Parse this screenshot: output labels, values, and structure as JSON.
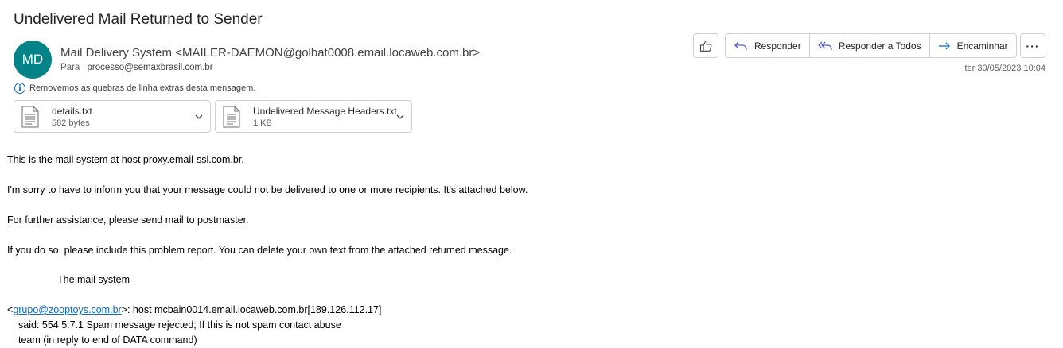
{
  "email": {
    "subject": "Undelivered Mail Returned to Sender",
    "avatar_initials": "MD",
    "avatar_color": "#038387",
    "sender": "Mail Delivery System <MAILER-DAEMON@golbat0008.email.locaweb.com.br>",
    "to_label": "Para",
    "to_address": "processo@semaxbrasil.com.br",
    "info_notice": "Removemos as quebras de linha extras desta mensagem.",
    "date": "ter 30/05/2023 10:04"
  },
  "actions": {
    "like_icon": "thumbs-up-icon",
    "reply_label": "Responder",
    "reply_all_label": "Responder a Todos",
    "forward_label": "Encaminhar",
    "more_icon": "more-icon",
    "more_glyph": "···"
  },
  "attachments": [
    {
      "name": "details.txt",
      "size": "582 bytes",
      "icon": "text-file-icon"
    },
    {
      "name": "Undelivered Message Headers.txt",
      "size": "1 KB",
      "icon": "text-file-icon"
    }
  ],
  "body": {
    "line1": "This is the mail system at host proxy.email-ssl.com.br.",
    "line2": "I'm sorry to have to inform you that your message could not be delivered to one or more recipients. It's attached below.",
    "line3": "For further assistance, please send mail to postmaster.",
    "line4": "If you do so, please include this problem report. You can delete your own text from the attached returned message.",
    "line5": "The mail system",
    "recipient_prefix": "<",
    "recipient_link": "grupo@zooptoys.com.br",
    "recipient_suffix": ">: host mcbain0014.email.locaweb.com.br[189.126.112.17]",
    "line7": "said: 554 5.7.1 Spam message rejected; If this is not spam contact abuse",
    "line8": "team (in reply to end of DATA command)"
  },
  "colors": {
    "accent": "#0f6cbd",
    "border": "#d1d1d1"
  }
}
